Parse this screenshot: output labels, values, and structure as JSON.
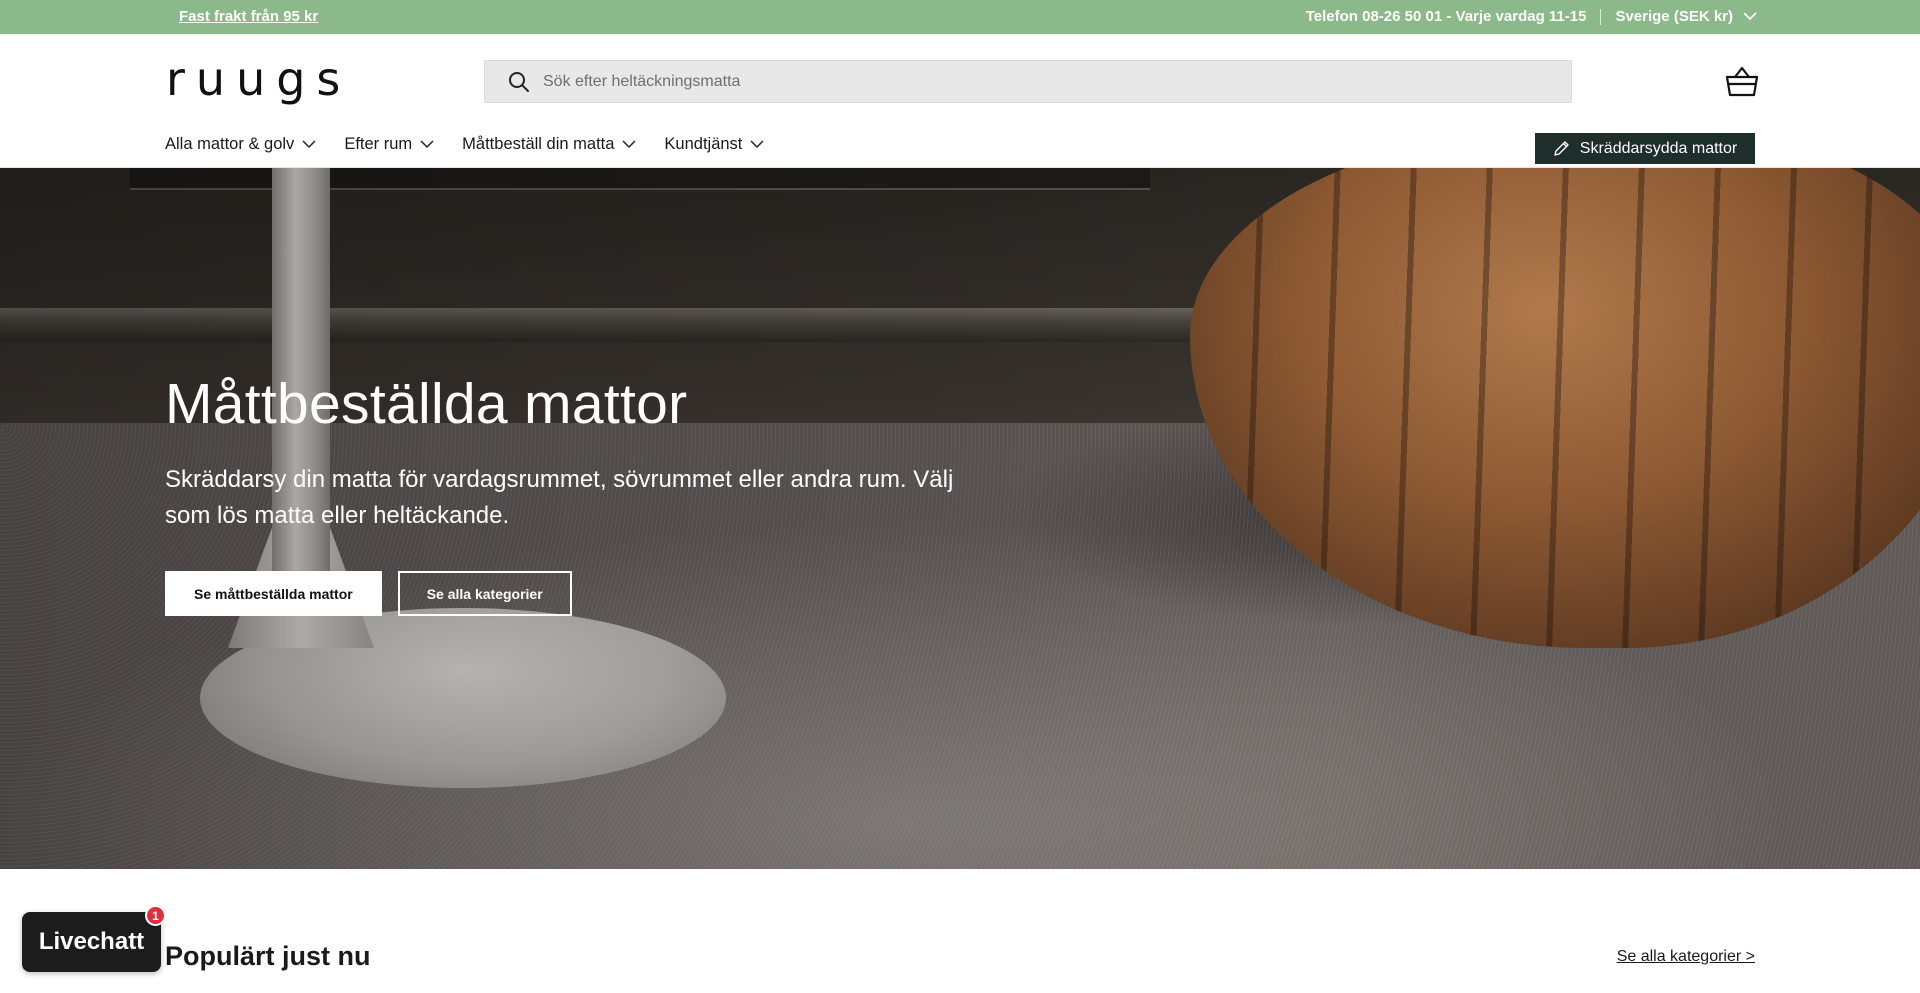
{
  "announcement": {
    "promo": "Fast frakt från 95 kr",
    "phone": "Telefon 08-26 50 01 - Varje vardag 11-15",
    "country": "Sverige (SEK kr)"
  },
  "header": {
    "logo": "ruugs",
    "search_placeholder": "Sök efter heltäckningsmatta",
    "nav": [
      {
        "label": "Alla mattor & golv"
      },
      {
        "label": "Efter rum"
      },
      {
        "label": "Måttbeställ din matta"
      },
      {
        "label": "Kundtjänst"
      }
    ],
    "cta": "Skräddarsydda mattor"
  },
  "hero": {
    "title": "Måttbeställda mattor",
    "subtitle": "Skräddarsy din matta för vardagsrummet, sövrummet eller andra rum. Välj som lös matta eller heltäckande.",
    "primary_button": "Se måttbeställda mattor",
    "secondary_button": "Se alla kategorier"
  },
  "popular": {
    "title": "Populärt just nu",
    "link": "Se alla kategorier >"
  },
  "livechat": {
    "label": "Livechatt",
    "badge": "1"
  },
  "colors": {
    "announcement_bg": "#8cb98a",
    "cta_bg": "#1e2e2a",
    "badge": "#e0303c"
  }
}
